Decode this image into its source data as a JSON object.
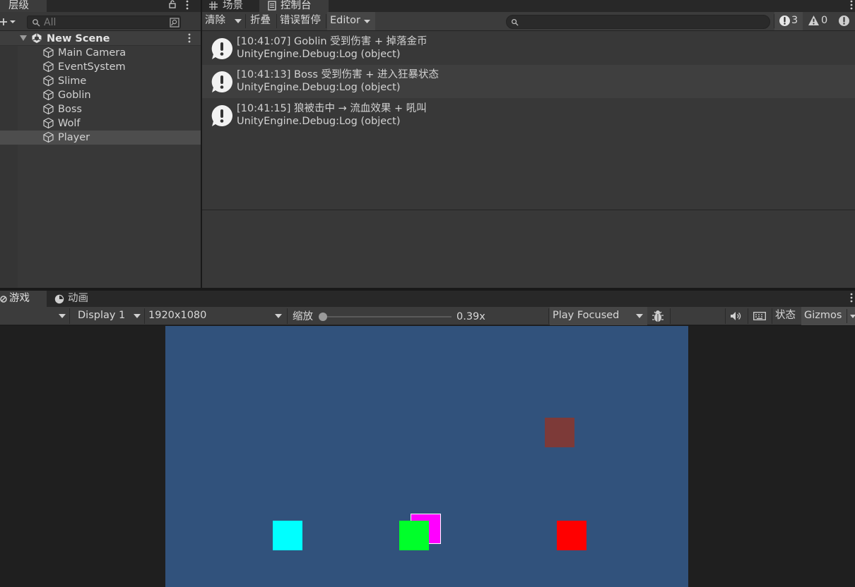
{
  "hierarchy": {
    "tab_label": "层级",
    "search_placeholder": "All",
    "scene_name": "New Scene",
    "items": [
      {
        "label": "Main Camera"
      },
      {
        "label": "EventSystem"
      },
      {
        "label": "Slime"
      },
      {
        "label": "Goblin"
      },
      {
        "label": "Boss"
      },
      {
        "label": "Wolf"
      },
      {
        "label": "Player",
        "selected": true
      }
    ]
  },
  "tabs": {
    "scene": "场景",
    "console": "控制台",
    "game": "游戏",
    "animation": "动画"
  },
  "console": {
    "toolbar": {
      "clear": "清除",
      "collapse": "折叠",
      "error_pause": "错误暂停",
      "editor": "Editor"
    },
    "counts": {
      "info": "3",
      "warning": "0"
    },
    "logs": [
      {
        "message": "[10:41:07] Goblin 受到伤害 + 掉落金币",
        "source": "UnityEngine.Debug:Log (object)"
      },
      {
        "message": "[10:41:13] Boss 受到伤害 + 进入狂暴状态",
        "source": "UnityEngine.Debug:Log (object)"
      },
      {
        "message": "[10:41:15] 狼被击中 → 流血效果 + 吼叫",
        "source": "UnityEngine.Debug:Log (object)"
      }
    ]
  },
  "game": {
    "display": "Display 1",
    "resolution": "1920x1080",
    "scale_label": "缩放",
    "scale_value": "0.39x",
    "play_mode": "Play Focused",
    "stats": "状态",
    "gizmos": "Gizmos",
    "colors": {
      "background": "#31527c",
      "cyan": "#00ffff",
      "green": "#00ff2a",
      "magenta": "#ff00ff",
      "red": "#ff0000",
      "brown": "#7d3a38"
    }
  }
}
